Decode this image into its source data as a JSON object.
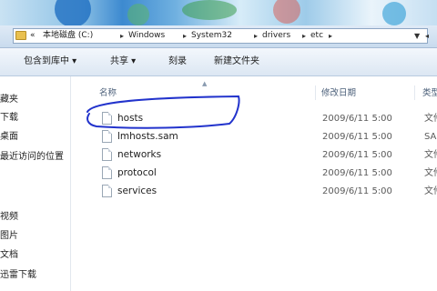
{
  "address_bar": {
    "overflow": "«",
    "path": [
      "本地磁盘 (C:)",
      "Windows",
      "System32",
      "drivers",
      "etc"
    ]
  },
  "toolbar": {
    "include_in_library": "包含到库中 ▾",
    "share": "共享 ▾",
    "burn": "刻录",
    "new_folder": "新建文件夹"
  },
  "nav_pane": {
    "items": [
      "藏夹",
      "下载",
      "桌面",
      "最近访问的位置",
      "",
      "",
      "视频",
      "图片",
      "文档",
      "迅雷下载"
    ]
  },
  "columns": {
    "name": "名称",
    "date_modified": "修改日期",
    "type": "类型"
  },
  "files": [
    {
      "name": "hosts",
      "date": "2009/6/11 5:00",
      "type": "文件"
    },
    {
      "name": "lmhosts.sam",
      "date": "2009/6/11 5:00",
      "type": "SAM"
    },
    {
      "name": "networks",
      "date": "2009/6/11 5:00",
      "type": "文件"
    },
    {
      "name": "protocol",
      "date": "2009/6/11 5:00",
      "type": "文件"
    },
    {
      "name": "services",
      "date": "2009/6/11 5:00",
      "type": "文件"
    }
  ],
  "colors": {
    "highlight_circle": "#2233cc",
    "header_text": "#4c607a"
  }
}
